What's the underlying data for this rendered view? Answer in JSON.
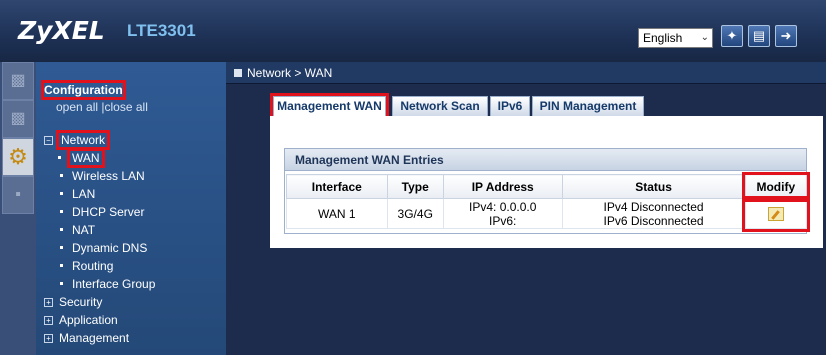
{
  "header": {
    "brand": "ZyXEL",
    "model": "LTE3301",
    "language": "English"
  },
  "icons": {
    "wizard": "wizard-icon",
    "about": "document-icon",
    "logout": "logout-icon"
  },
  "menu": {
    "title": "Configuration",
    "open_all": "open all",
    "separator": "|",
    "close_all": "close all",
    "network": "Network",
    "items": [
      "WAN",
      "Wireless LAN",
      "LAN",
      "DHCP Server",
      "NAT",
      "Dynamic DNS",
      "Routing",
      "Interface Group"
    ],
    "groups": [
      "Security",
      "Application",
      "Management"
    ]
  },
  "breadcrumb": "Network > WAN",
  "tabs": [
    "Management WAN",
    "Network Scan",
    "IPv6",
    "PIN Management"
  ],
  "section_title": "Management WAN Entries",
  "table": {
    "headers": [
      "Interface",
      "Type",
      "IP Address",
      "Status",
      "Modify"
    ],
    "row": {
      "interface": "WAN 1",
      "type": "3G/4G",
      "ipv4": "IPv4: 0.0.0.0",
      "ipv6": "IPv6:",
      "status_v4": "IPv4 Disconnected",
      "status_v6": "IPv6 Disconnected"
    }
  },
  "colors": {
    "highlight": "#e2121c",
    "header_bg": "#1f3358",
    "menu_bg": "#2f5a94"
  }
}
